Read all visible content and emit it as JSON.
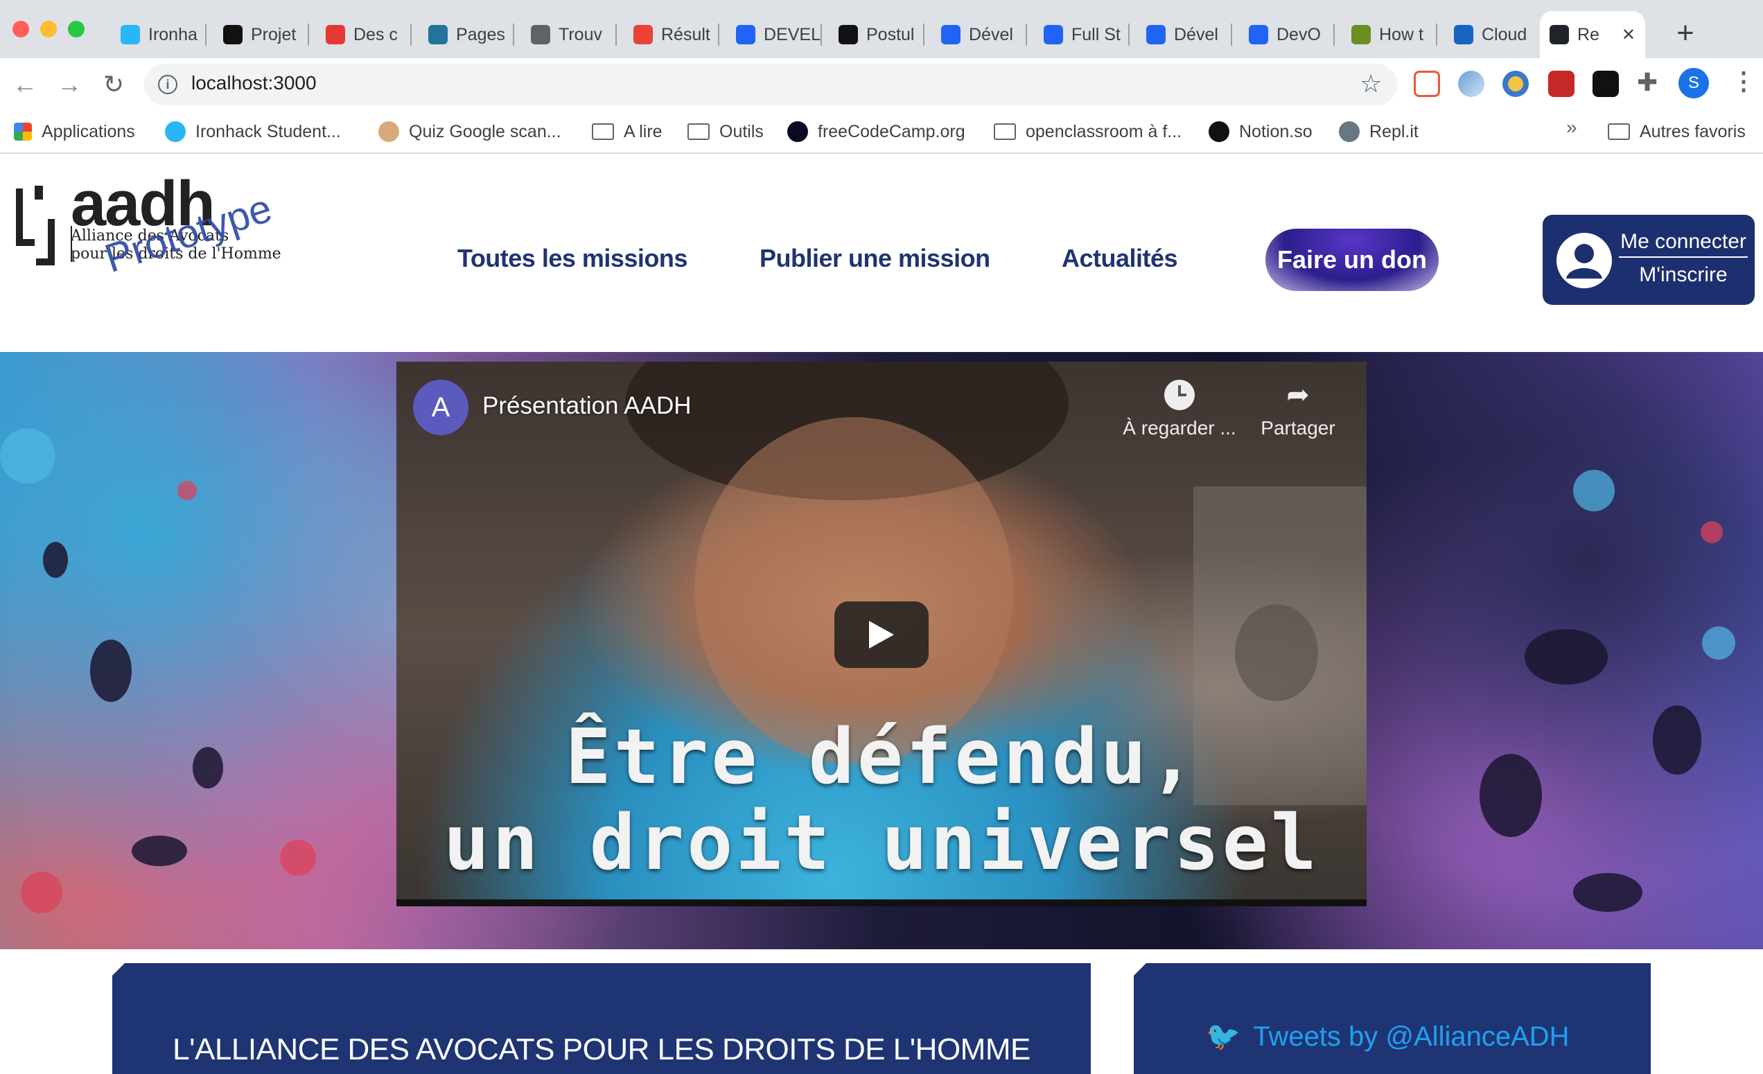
{
  "browser": {
    "tabs": [
      {
        "title": "Ironha",
        "icon": "ironhack-icon",
        "color": "#29b6f6"
      },
      {
        "title": "Projet",
        "icon": "notion-icon",
        "color": "#111111"
      },
      {
        "title": "Des c",
        "icon": "udemy-icon",
        "color": "#e53935"
      },
      {
        "title": "Pages",
        "icon": "wordpress-icon",
        "color": "#21759b"
      },
      {
        "title": "Trouv",
        "icon": "globe-icon",
        "color": "#5f6368"
      },
      {
        "title": "Résult",
        "icon": "gmail-icon",
        "color": "#ea4335"
      },
      {
        "title": "DEVEL",
        "icon": "indeed-icon",
        "color": "#2164f3"
      },
      {
        "title": "Postul",
        "icon": "hc-icon",
        "color": "#111111"
      },
      {
        "title": "Dével",
        "icon": "indeed-icon",
        "color": "#2164f3"
      },
      {
        "title": "Full St",
        "icon": "indeed-icon",
        "color": "#2164f3"
      },
      {
        "title": "Dével",
        "icon": "indeed-icon",
        "color": "#2164f3"
      },
      {
        "title": "DevO",
        "icon": "indeed-icon",
        "color": "#2164f3"
      },
      {
        "title": "How t",
        "icon": "leaf-icon",
        "color": "#6b8e23"
      },
      {
        "title": "Cloud",
        "icon": "cloud-icon",
        "color": "#1565c0"
      },
      {
        "title": "Re",
        "icon": "react-icon",
        "color": "#20232a",
        "active": true
      }
    ],
    "url": "localhost:3000",
    "profile_initial": "S",
    "bookmarks": [
      {
        "label": "Applications",
        "icon": "apps-grid-icon"
      },
      {
        "label": "Ironhack Student...",
        "icon": "ironhack-icon"
      },
      {
        "label": "Quiz Google scan...",
        "icon": "face-icon"
      },
      {
        "label": "A lire",
        "icon": "folder-icon"
      },
      {
        "label": "Outils",
        "icon": "folder-icon"
      },
      {
        "label": "freeCodeCamp.org",
        "icon": "freecodecamp-icon"
      },
      {
        "label": "openclassroom à f...",
        "icon": "folder-icon"
      },
      {
        "label": "Notion.so",
        "icon": "notion-icon"
      },
      {
        "label": "Repl.it",
        "icon": "replit-icon"
      }
    ],
    "bookmarks_overflow": "»",
    "other_bookmarks": "Autres favoris"
  },
  "header": {
    "logo": {
      "name": "aadh",
      "line1": "Alliance des Avocats",
      "line2": "pour les droits de l'Homme",
      "stamp": "Prototype"
    },
    "nav": [
      "Toutes les missions",
      "Publier une mission",
      "Actualités"
    ],
    "donate": "Faire un don",
    "login": "Me connecter",
    "signup": "M'inscrire"
  },
  "video": {
    "channel_initial": "A",
    "title": "Présentation AADH",
    "watch_later": "À regarder ...",
    "share": "Partager",
    "caption_line1": "Être défendu,",
    "caption_line2": "un droit universel"
  },
  "sections": {
    "alliance_title": "L'ALLIANCE DES AVOCATS POUR LES DROITS DE L'HOMME",
    "tweets_title": "Tweets by @AllianceADH"
  },
  "colors": {
    "brand_navy": "#1f3473",
    "twitter_blue": "#1da1f2",
    "donate_purple": "#2a1f8c"
  }
}
